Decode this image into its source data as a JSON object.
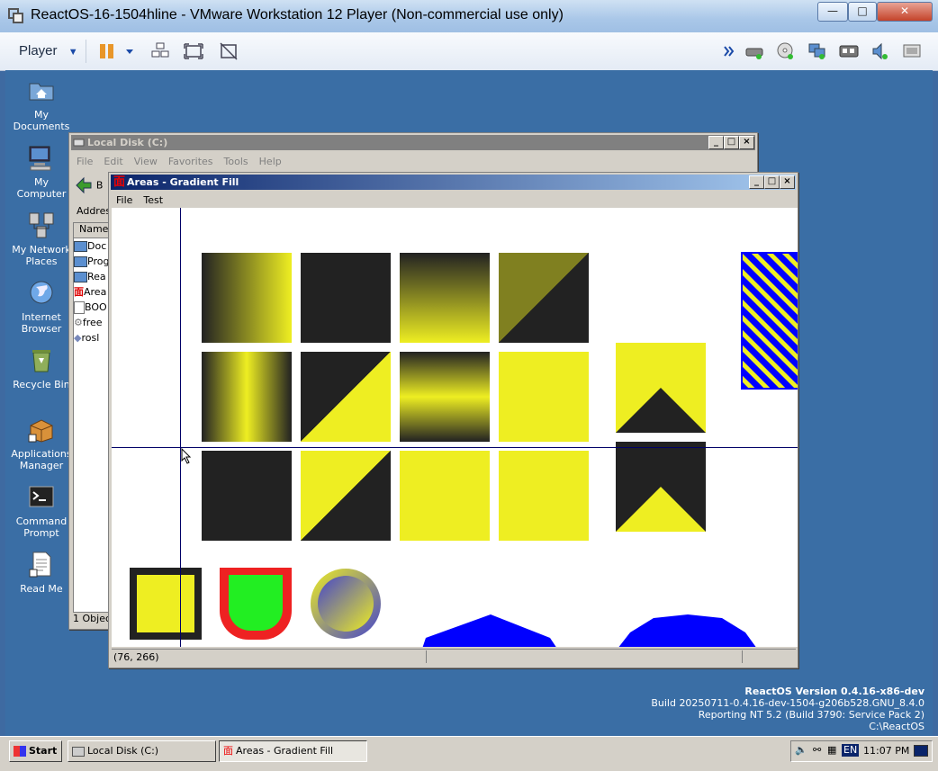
{
  "vm": {
    "title": "ReactOS-16-1504hline - VMware Workstation 12 Player (Non-commercial use only)",
    "player_label": "Player",
    "min": "—",
    "max": "□",
    "close": "✕"
  },
  "desktop_icons": [
    {
      "l1": "My",
      "l2": "Documents"
    },
    {
      "l1": "My",
      "l2": "Computer"
    },
    {
      "l1": "My Network",
      "l2": "Places"
    },
    {
      "l1": "Internet",
      "l2": "Browser"
    },
    {
      "l1": "Recycle Bin",
      "l2": ""
    },
    {
      "l1": "Applications",
      "l2": "Manager"
    },
    {
      "l1": "Command",
      "l2": "Prompt"
    },
    {
      "l1": "Read Me",
      "l2": ""
    }
  ],
  "explorer": {
    "title": "Local Disk (C:)",
    "menu": [
      "File",
      "Edit",
      "View",
      "Favorites",
      "Tools",
      "Help"
    ],
    "back_label": "B",
    "address_label": "Addres",
    "column_name": "Name",
    "files": [
      "Doc",
      "Prog",
      "Rea",
      "Area",
      "BOO",
      "free",
      "rosl"
    ],
    "status": "1 Objec"
  },
  "gradient_window": {
    "title": "Areas - Gradient Fill",
    "menu": [
      "File",
      "Test"
    ],
    "status_coords": "(76, 266)"
  },
  "reactos_info": {
    "version": "ReactOS Version 0.4.16-x86-dev",
    "build": "Build 20250711-0.4.16-dev-1504-g206b528.GNU_8.4.0",
    "reporting": "Reporting NT 5.2 (Build 3790: Service Pack 2)",
    "path": "C:\\ReactOS"
  },
  "taskbar": {
    "start": "Start",
    "tasks": [
      "Local Disk (C:)",
      "Areas - Gradient Fill"
    ],
    "lang": "EN",
    "clock": "11:07 PM"
  },
  "colors": {
    "yellow": "#eeee22",
    "dark": "#222222",
    "olive": "#808020",
    "blue": "#0000ff",
    "green": "#22ee22",
    "red": "#ee2222"
  }
}
